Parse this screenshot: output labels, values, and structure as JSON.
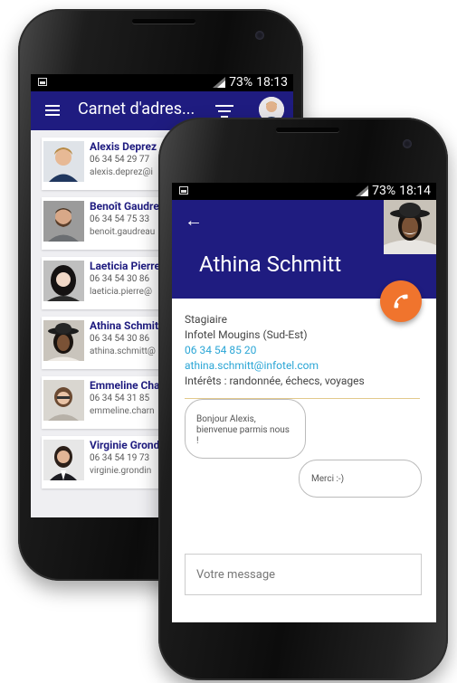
{
  "contacts_screen": {
    "status_bar": {
      "battery": "73%",
      "time": "18:13"
    },
    "toolbar": {
      "title": "Carnet d'adres..."
    },
    "contacts": [
      {
        "name": "Alexis Deprez",
        "phone": "06 34 54 29 77",
        "email": "alexis.deprez@i",
        "photo": "avatar-male-blond"
      },
      {
        "name": "Benoît Gaudre",
        "phone": "06 34 54 75 33",
        "email": "benoit.gaudreau",
        "photo": "avatar-male-beard"
      },
      {
        "name": "Laeticia Pierre",
        "phone": "06 34 54 30 86",
        "email": "laeticia.pierre@",
        "photo": "avatar-female-dark-hair"
      },
      {
        "name": "Athina Schmit",
        "phone": "06 34 54 30 86",
        "email": "athina.schmitt@",
        "photo": "avatar-female-hat"
      },
      {
        "name": "Emmeline Cha",
        "phone": "06 34 54 31 85",
        "email": "emmeline.charn",
        "photo": "avatar-female-glasses"
      },
      {
        "name": "Virginie Grond",
        "phone": "06 34 54 19 73",
        "email": "virginie.grondin",
        "photo": "avatar-female-business"
      }
    ]
  },
  "detail_screen": {
    "status_bar": {
      "battery": "73%",
      "time": "18:14"
    },
    "contact_name": "Athina Schmitt",
    "info": {
      "role": "Stagiaire",
      "company": "Infotel Mougins (Sud-Est)",
      "phone": "06 34 54 85 20",
      "email": "athina.schmitt@infotel.com",
      "interests": "Intérêts : randonnée, échecs, voyages"
    },
    "messages": [
      {
        "text": "Bonjour Alexis, bienvenue parmis nous !",
        "side": "left"
      },
      {
        "text": "Merci :-)",
        "side": "right"
      }
    ],
    "composer": {
      "placeholder": "Votre message"
    }
  },
  "colors": {
    "primary": "#1f1c80",
    "accent": "#f0742d",
    "link": "#2ba6d6"
  }
}
